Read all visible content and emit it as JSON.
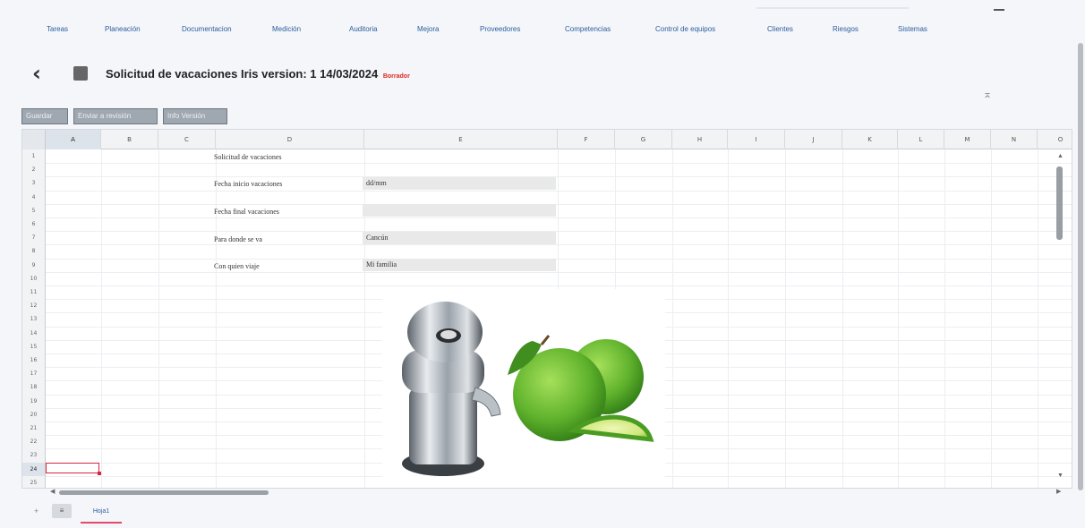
{
  "nav": {
    "tabs": [
      "Tareas",
      "Planeación",
      "Documentacion",
      "Medición",
      "Auditoria",
      "Mejora",
      "Proveedores",
      "Competencias",
      "Control de equipos",
      "Clientes",
      "Riesgos",
      "Sistemas"
    ]
  },
  "header": {
    "back_icon": "chevron-left-icon",
    "save_icon": "square-icon",
    "title": "Solicitud de vacaciones Iris version: 1 14/03/2024",
    "badge": "Borrador",
    "collapse_icon": "collapse-icon",
    "collapse_glyph": "⌅"
  },
  "toolbar": {
    "buttons": [
      "Guardar",
      "Enviar a revisión",
      "Info Versión"
    ]
  },
  "sheet": {
    "columns": [
      "A",
      "B",
      "C",
      "D",
      "E",
      "F",
      "G",
      "H",
      "I",
      "J",
      "K",
      "L",
      "M",
      "N",
      "O"
    ],
    "rows": [
      "1",
      "2",
      "3",
      "4",
      "5",
      "6",
      "7",
      "8",
      "9",
      "10",
      "11",
      "12",
      "13",
      "14",
      "15",
      "16",
      "17",
      "18",
      "19",
      "20",
      "21",
      "22",
      "23",
      "24",
      "25"
    ],
    "selected_column": "A",
    "selected_row": "24",
    "cells": {
      "D1": "Solicitud de vacaciones",
      "D3": "Fecha inicio vacaciones",
      "E3": "dd/mm",
      "D5": "Fecha final vacaciones",
      "E5": "",
      "D7": "Para donde se va",
      "E7": "Cancún",
      "D9": "Con quien viaje",
      "E9": "Mi familia"
    },
    "image_alt": "juicer-and-limes-image"
  },
  "footer": {
    "add_sheet": "+",
    "sheets_menu": "≡",
    "sheet_tab": "Hoja1"
  },
  "colors": {
    "accent": "#2c5d9c",
    "badge": "#e0261f",
    "active_cell": "#d7263d",
    "sheet_tab_underline": "#e14b6b"
  }
}
